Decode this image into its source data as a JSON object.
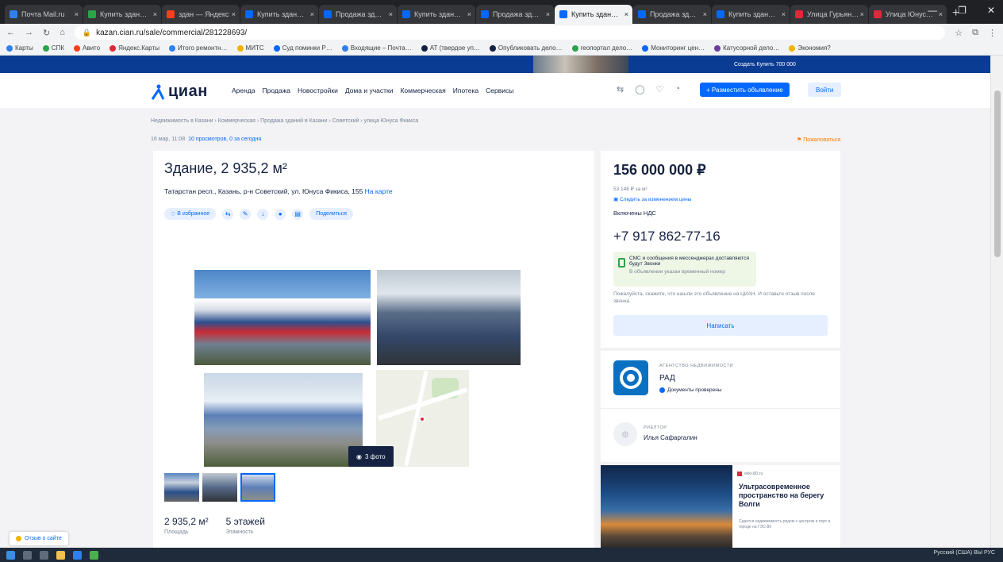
{
  "browser": {
    "tabs": [
      {
        "label": "Почта Mail.ru",
        "color": "#2f80ed"
      },
      {
        "label": "Купить здан…",
        "color": "#2ca44a"
      },
      {
        "label": "здан — Яндекс",
        "color": "#fc3f1d"
      },
      {
        "label": "Купить здан…",
        "color": "#0468ff"
      },
      {
        "label": "Продажа зд…",
        "color": "#0468ff"
      },
      {
        "label": "Купить здан…",
        "color": "#0468ff"
      },
      {
        "label": "Продажа зд…",
        "color": "#0468ff"
      },
      {
        "label": "Купить здан…",
        "color": "#0468ff"
      },
      {
        "label": "Продажа зд…",
        "color": "#0468ff"
      },
      {
        "label": "Купить здан…",
        "color": "#0468ff"
      },
      {
        "label": "Улица Гурьян…",
        "color": "#e0283b"
      },
      {
        "label": "Улица Юнус…",
        "color": "#e0283b"
      }
    ],
    "url": "kazan.cian.ru/sale/commercial/281228693/",
    "bookmarks": [
      "Карты",
      "СПК",
      "Авито",
      "Яндекс.Карты",
      "Итого ремонтн…",
      "МИТС",
      "Суд поминки Р…",
      "Входящие – Почта…",
      "АТ (твердое уп…",
      "Опубликовать дело…",
      "геопортал дело…",
      "Мониторинг цен…",
      "Катусорной дело…",
      "Экономия?"
    ]
  },
  "banner": {
    "text": "Создать Купить 700 000"
  },
  "header": {
    "logo": "циан",
    "nav": [
      "Аренда",
      "Продажа",
      "Новостройки",
      "Дома и участки",
      "Коммерческая",
      "Ипотека",
      "Сервисы"
    ],
    "post_button": "+ Разместить объявление",
    "login_button": "Войти"
  },
  "breadcrumbs": "Недвижимость в Казани  ›  Коммерческая  ›  Продажа зданий в Казани  ›  Советский  ›  улица Юнуса Фикиса",
  "meta": {
    "date": "16 мар, 11:08",
    "views": "10 просмотров, 0 за сегодня"
  },
  "report": "Пожаловаться",
  "listing": {
    "title": "Здание, 2 935,2 м²",
    "address": "Татарстан респ., Казань, р-н Советский, ул. Юнуса Фикиса, 155",
    "map_link": "На карте",
    "favorite_label": "В избранное",
    "share_label": "Поделиться",
    "photo_count": "3 фото",
    "specs": [
      {
        "value": "2 935,2 м²",
        "label": "Площадь"
      },
      {
        "value": "5 этажей",
        "label": "Этажность"
      }
    ]
  },
  "price": {
    "value": "156 000 000 ₽",
    "per_meter": "53 148 ₽ за м²",
    "subscribe": "Следить за изменением цены",
    "vat": "Включены НДС",
    "phone": "+7 917 862-77-16",
    "sms_text": "СМС и сообщения в мессенджерах доставляются будут Звонки",
    "sms_sub": "В объявлении указан временный номер",
    "note": "Пожалуйста, скажите, что нашли это объявление на ЦИАН. И оставьте отзыв после звонка",
    "write_button": "Написать"
  },
  "agency": {
    "caption": "АГЕНТСТВО НЕДВИЖИМОСТИ",
    "name": "РАД",
    "verified": "Документы проверены",
    "realtor_caption": "РИЕЛТОР",
    "realtor_name": "Илья Сафаргалин"
  },
  "ad": {
    "source": "wiki-80.ru",
    "title": "Ультрасовременное пространство на берегу Волги",
    "text": "Сдается недвижимость рядом с центром и порт в городе на ГЭС-80"
  },
  "feedback": "Отзыв о сайте",
  "tray": "Русский (США)  ВЫ  РУС"
}
